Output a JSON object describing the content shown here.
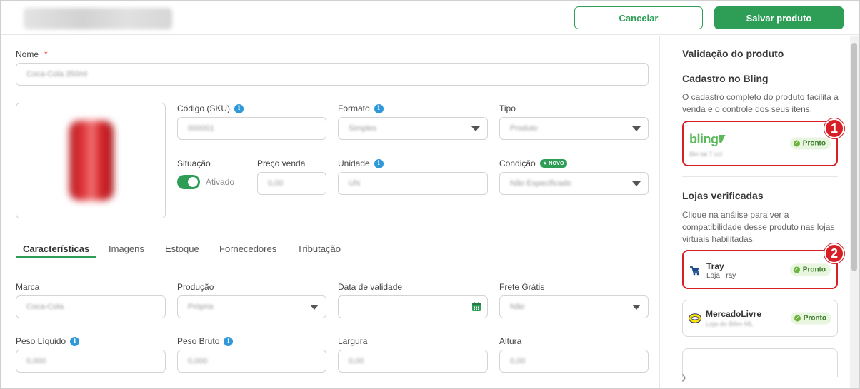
{
  "header": {
    "cancel_label": "Cancelar",
    "save_label": "Salvar produto"
  },
  "form": {
    "nome_label": "Nome",
    "nome_value": "Coca-Cola 350ml",
    "sku_label": "Código (SKU)",
    "sku_value": "000001",
    "formato_label": "Formato",
    "formato_value": "Simples",
    "tipo_label": "Tipo",
    "tipo_value": "Produto",
    "situacao_label": "Situação",
    "situacao_value": "Ativado",
    "preco_label": "Preço venda",
    "preco_value": "0,00",
    "unidade_label": "Unidade",
    "unidade_value": "UN",
    "condicao_label": "Condição",
    "condicao_badge": "NOVO",
    "condicao_value": "Não Especificado"
  },
  "tabs": [
    {
      "label": "Características"
    },
    {
      "label": "Imagens"
    },
    {
      "label": "Estoque"
    },
    {
      "label": "Fornecedores"
    },
    {
      "label": "Tributação"
    }
  ],
  "characteristics": {
    "marca_label": "Marca",
    "marca_value": "Coca-Cola",
    "producao_label": "Produção",
    "producao_value": "Própria",
    "validade_label": "Data de validade",
    "frete_label": "Frete Grátis",
    "frete_value": "Não",
    "peso_liquido_label": "Peso Líquido",
    "peso_liquido_value": "0,000",
    "peso_bruto_label": "Peso Bruto",
    "peso_bruto_value": "0,000",
    "largura_label": "Largura",
    "largura_value": "0,00",
    "altura_label": "Altura",
    "altura_value": "0,00"
  },
  "side": {
    "title": "Validação do produto",
    "bling_heading": "Cadastro no Bling",
    "bling_desc": "O cadastro completo do produto facilita a venda e o controle dos seus itens.",
    "bling_logo": "bling",
    "bling_sub": "Bin tal 7 ccl",
    "status_ready": "Pronto",
    "stores_heading": "Lojas verificadas",
    "stores_desc": "Clique na análise para ver a compatibilidade desse produto nas lojas virtuais habilitadas.",
    "stores": [
      {
        "name": "Tray",
        "sub": "Loja Tray",
        "status": "Pronto"
      },
      {
        "name": "MercadoLivre",
        "sub": "Loja do Bilim ML",
        "status": "Pronto"
      }
    ],
    "marker_1": "1",
    "marker_2": "2"
  },
  "colors": {
    "brand_green": "#2e9e57",
    "highlight_red": "#d81f26",
    "info_blue": "#2e98d8"
  }
}
